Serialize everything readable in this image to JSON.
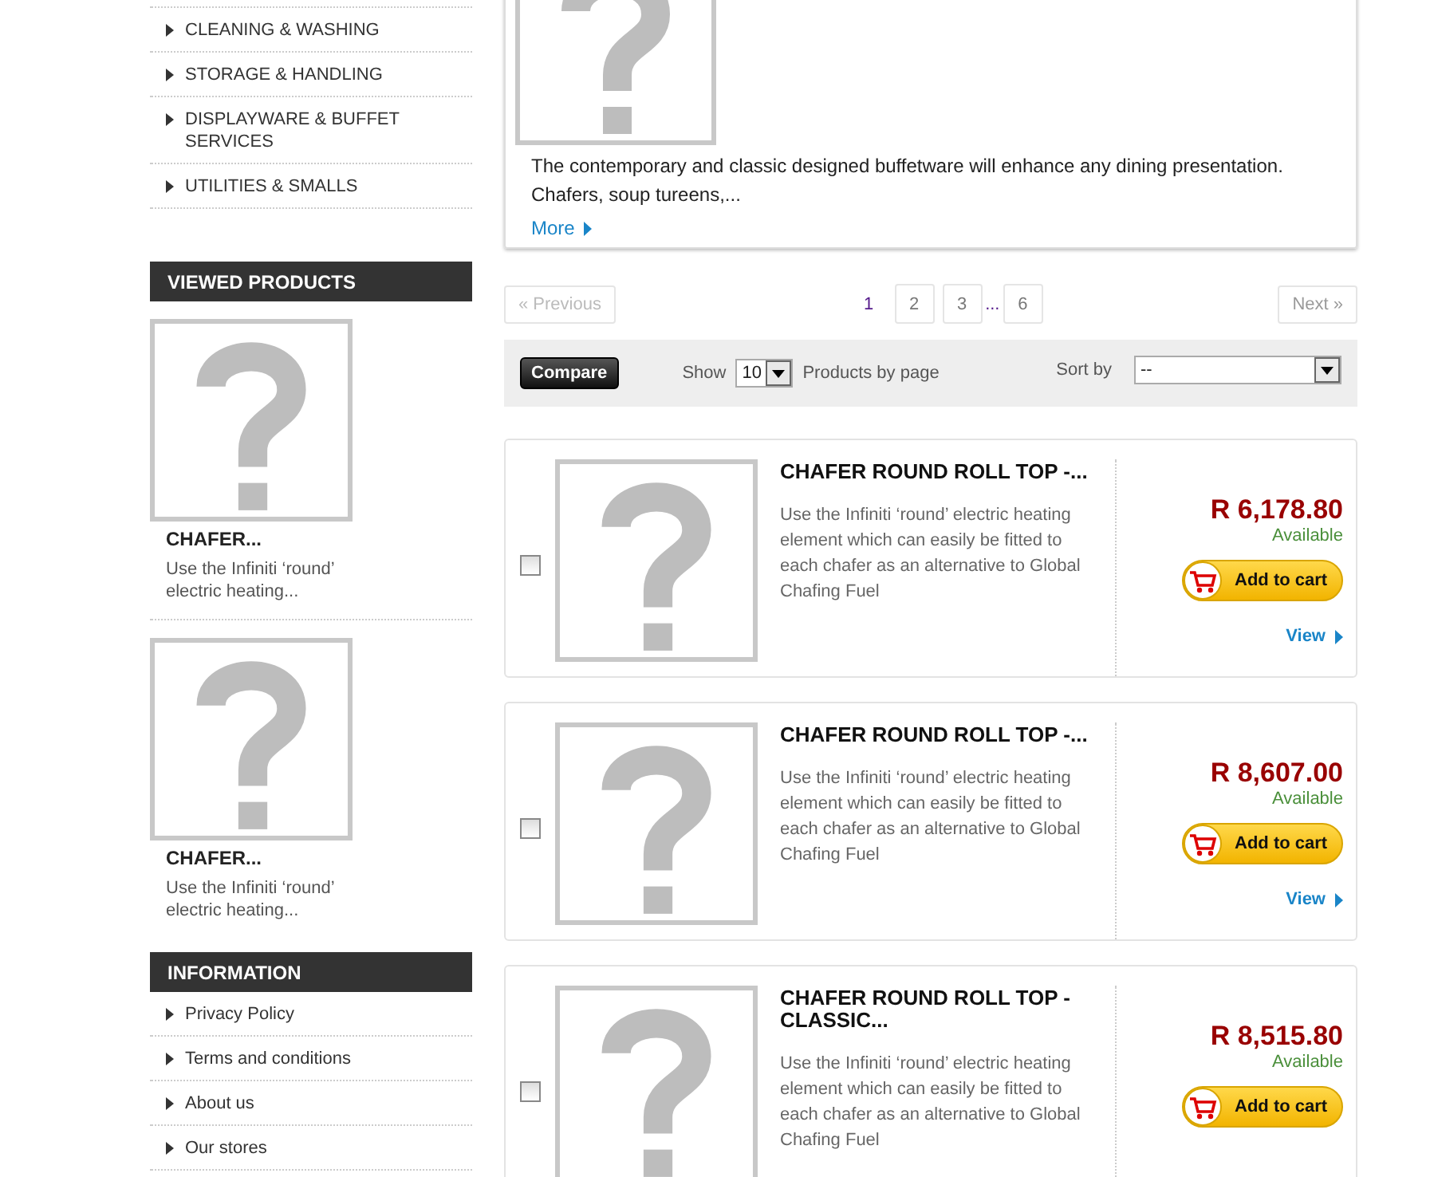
{
  "categories": [
    {
      "label": "CLEANING & WASHING"
    },
    {
      "label": "STORAGE & HANDLING"
    },
    {
      "label": "DISPLAYWARE & BUFFET SERVICES"
    },
    {
      "label": "UTILITIES & SMALLS"
    }
  ],
  "viewed_products": {
    "title": "VIEWED PRODUCTS",
    "items": [
      {
        "name": "CHAFER...",
        "description": "Use the Infiniti ‘round’ electric heating..."
      },
      {
        "name": "CHAFER...",
        "description": "Use the Infiniti ‘round’ electric heating..."
      }
    ]
  },
  "information": {
    "title": "INFORMATION",
    "links": [
      "Privacy Policy",
      "Terms and conditions",
      "About us",
      "Our stores"
    ]
  },
  "category_info": {
    "description": "The contemporary and classic designed buffetware will enhance any dining presentation. Chafers, soup tureens,...",
    "more": "More"
  },
  "pagination": {
    "previous": "« Previous",
    "pages": [
      {
        "label": "1",
        "selected": true
      },
      {
        "label": "2",
        "selected": false
      },
      {
        "label": "3",
        "selected": false
      },
      {
        "label": "...",
        "kind": "gap"
      },
      {
        "label": "6",
        "selected": false
      }
    ],
    "next": "Next »"
  },
  "toolbar": {
    "compare": "Compare",
    "show_label": "Show",
    "per_page": "10",
    "per_page_label": "Products by page",
    "sort_label": "Sort by",
    "sort_value": "--"
  },
  "products": [
    {
      "name": "CHAFER ROUND ROLL TOP -...",
      "description": "Use the Infiniti ‘round’ electric heating element which can easily be fitted to each chafer as an alternative to Global Chafing Fuel",
      "price": "R 6,178.80",
      "availability": "Available",
      "add_to_cart": "Add to cart",
      "view": "View",
      "checked": false
    },
    {
      "name": "CHAFER ROUND ROLL TOP -...",
      "description": "Use the Infiniti ‘round’ electric heating element which can easily be fitted to each chafer as an alternative to Global Chafing Fuel",
      "price": "R 8,607.00",
      "availability": "Available",
      "add_to_cart": "Add to cart",
      "view": "View",
      "checked": false
    },
    {
      "name": "CHAFER ROUND ROLL TOP - CLASSIC...",
      "description": "Use the Infiniti ‘round’ electric heating element which can easily be fitted to each chafer as an alternative to Global Chafing Fuel",
      "price": "R 8,515.80",
      "availability": "Available",
      "add_to_cart": "Add to cart",
      "checked": false
    }
  ]
}
